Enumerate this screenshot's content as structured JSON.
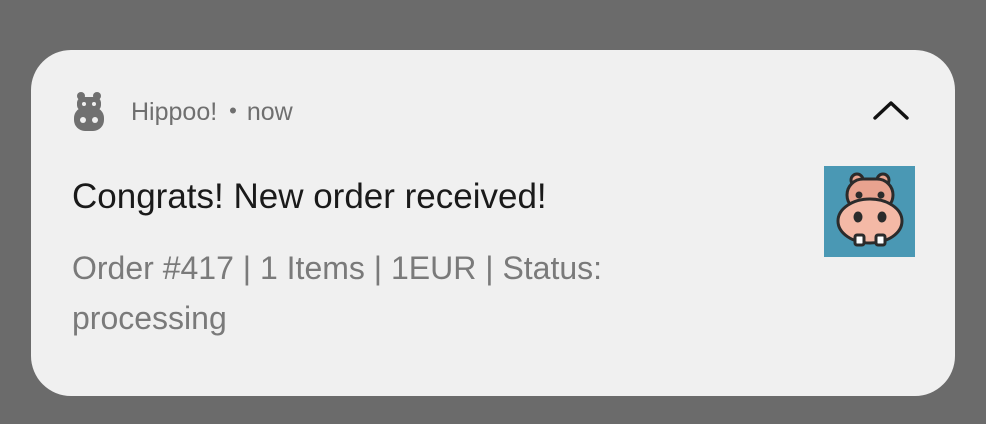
{
  "notification": {
    "app_name": "Hippoo!",
    "separator": "•",
    "time": "now",
    "title": "Congrats! New order received!",
    "body": "Order #417 | 1 Items | 1EUR | Status: processing",
    "icons": {
      "app": "hippo-app-icon",
      "collapse": "chevron-up-icon",
      "thumbnail": "hippo-avatar-icon"
    },
    "colors": {
      "card_background": "#f0f0f0",
      "screen_background": "#6b6b6b",
      "thumbnail_background": "#4a98b4",
      "hippo_skin": "#e8a38f"
    }
  }
}
